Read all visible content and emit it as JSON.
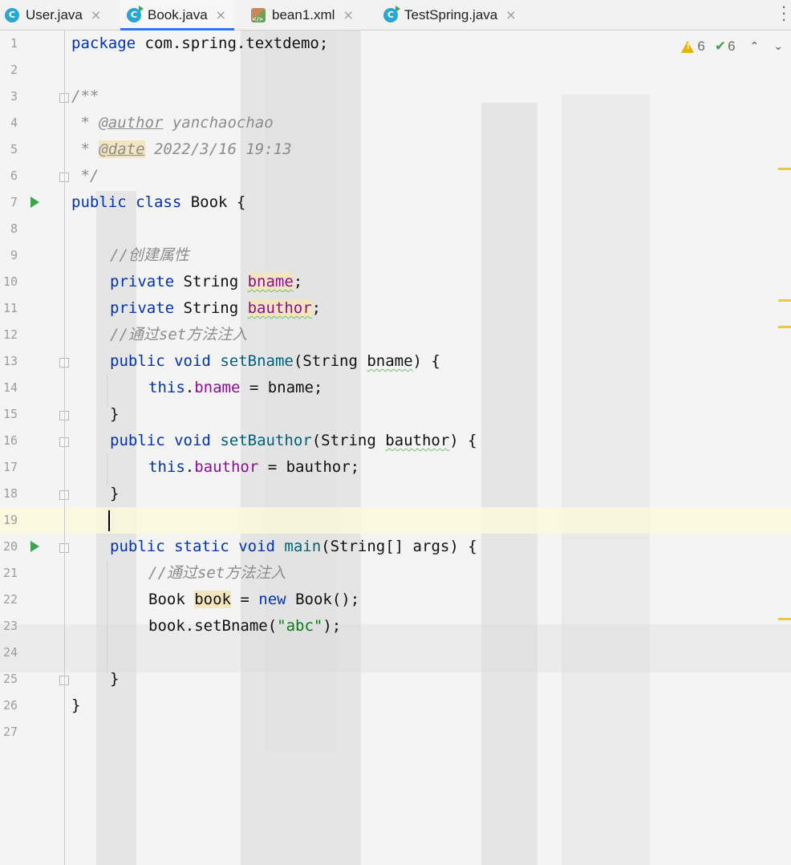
{
  "tabs": [
    {
      "label": "User.java",
      "icon": "class-icon",
      "active": false
    },
    {
      "label": "Book.java",
      "icon": "class-run-icon",
      "active": true
    },
    {
      "label": "bean1.xml",
      "icon": "xml-file-icon",
      "active": false
    },
    {
      "label": "TestSpring.java",
      "icon": "class-icon",
      "active": false
    }
  ],
  "tab_close_glyph": "×",
  "tab_icon_letter": "C",
  "inspection": {
    "warnings": "6",
    "weak_warnings": "6"
  },
  "line_numbers": [
    "1",
    "2",
    "3",
    "4",
    "5",
    "6",
    "7",
    "8",
    "9",
    "10",
    "11",
    "12",
    "13",
    "14",
    "15",
    "16",
    "17",
    "18",
    "19",
    "20",
    "21",
    "22",
    "23",
    "24",
    "25",
    "26",
    "27"
  ],
  "code": {
    "l1": {
      "kw": "package",
      "rest": " com.spring.textdemo;"
    },
    "l3": "/**",
    "l4": {
      "prefix": " * ",
      "tag": "@author",
      "text": " yanchaochao"
    },
    "l5": {
      "prefix": " * ",
      "tag": "@date",
      "text": " 2022/3/16 19:13"
    },
    "l6": " */",
    "l7": {
      "kw1": "public",
      "kw2": "class",
      "name": " Book {"
    },
    "l9": "//创建属性",
    "l10": {
      "kw": "private",
      "type": " String ",
      "var": "bname",
      "end": ";"
    },
    "l11": {
      "kw": "private",
      "type": " String ",
      "var": "bauthor",
      "end": ";"
    },
    "l12": "//通过set方法注入",
    "l13": {
      "kw1": "public",
      "kw2": "void",
      "fn": "setBname",
      "open": "(String ",
      "param": "bname",
      "close": ") {"
    },
    "l14": {
      "kw": "this",
      "dot": ".",
      "fld": "bname",
      "rest": " = bname;"
    },
    "l15": "}",
    "l16": {
      "kw1": "public",
      "kw2": "void",
      "fn": "setBauthor",
      "open": "(String ",
      "param": "bauthor",
      "close": ") {"
    },
    "l17": {
      "kw": "this",
      "dot": ".",
      "fld": "bauthor",
      "rest": " = bauthor;"
    },
    "l18": "}",
    "l20": {
      "kw1": "public",
      "kw2": "static",
      "kw3": "void",
      "fn": "main",
      "rest": "(String[] args) {"
    },
    "l21": "//通过set方法注入",
    "l22": {
      "type": "Book ",
      "var": "book",
      "eq": " = ",
      "kw": "new",
      "rest": " Book();"
    },
    "l23": {
      "pre": "book.setBname(",
      "str": "\"abc\"",
      "post": ");"
    },
    "l25": "}",
    "l26": "}"
  }
}
